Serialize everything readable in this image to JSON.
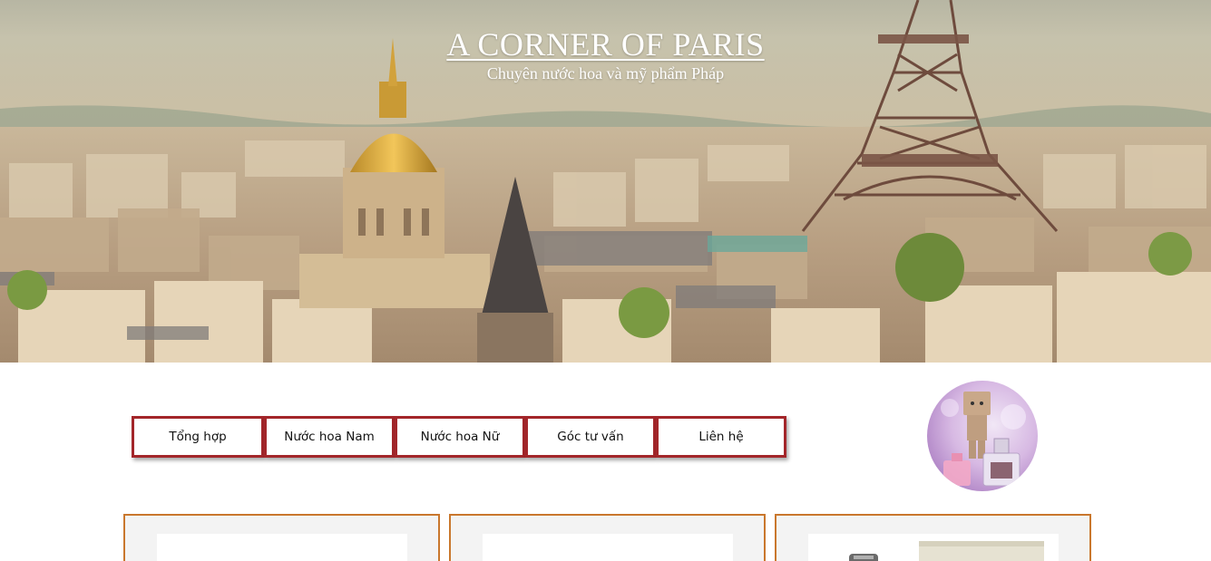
{
  "hero": {
    "title": "A CORNER OF PARIS",
    "subtitle": "Chuyên nước hoa và mỹ phẩm Pháp"
  },
  "nav": {
    "items": [
      {
        "label": "Tổng hợp"
      },
      {
        "label": "Nước hoa Nam"
      },
      {
        "label": "Nước hoa Nữ"
      },
      {
        "label": "Góc tư vấn"
      },
      {
        "label": "Liên hệ"
      }
    ]
  },
  "colors": {
    "nav_border": "#a3262a",
    "card_border": "#c9772d",
    "card_background": "#f3f3f3"
  },
  "icons": {
    "avatar": "perfume-robot-avatar"
  }
}
